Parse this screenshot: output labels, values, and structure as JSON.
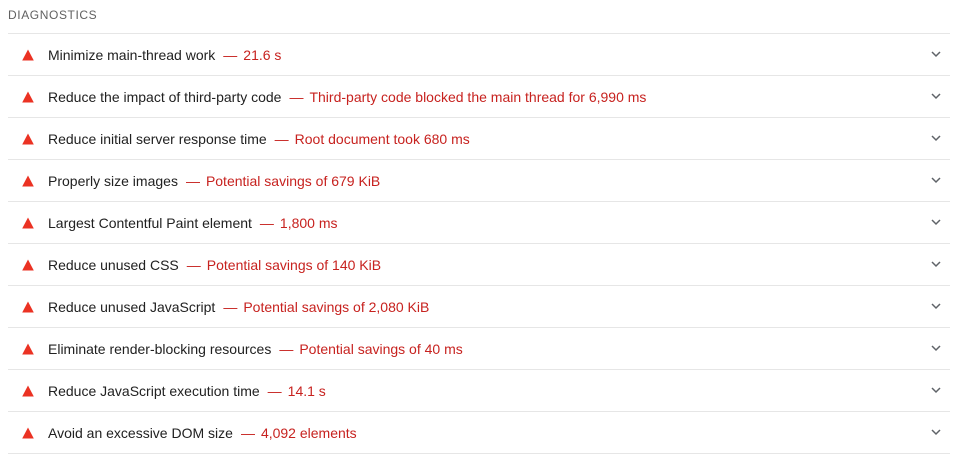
{
  "section": {
    "title": "DIAGNOSTICS"
  },
  "audits": [
    {
      "title": "Minimize main-thread work",
      "separator": "—",
      "value": "21.6 s"
    },
    {
      "title": "Reduce the impact of third-party code",
      "separator": "—",
      "value": "Third-party code blocked the main thread for 6,990 ms"
    },
    {
      "title": "Reduce initial server response time",
      "separator": "—",
      "value": "Root document took 680 ms"
    },
    {
      "title": "Properly size images",
      "separator": "—",
      "value": "Potential savings of 679 KiB"
    },
    {
      "title": "Largest Contentful Paint element",
      "separator": "—",
      "value": "1,800 ms"
    },
    {
      "title": "Reduce unused CSS",
      "separator": "—",
      "value": "Potential savings of 140 KiB"
    },
    {
      "title": "Reduce unused JavaScript",
      "separator": "—",
      "value": "Potential savings of 2,080 KiB"
    },
    {
      "title": "Eliminate render-blocking resources",
      "separator": "—",
      "value": "Potential savings of 40 ms"
    },
    {
      "title": "Reduce JavaScript execution time",
      "separator": "—",
      "value": "14.1 s"
    },
    {
      "title": "Avoid an excessive DOM size",
      "separator": "—",
      "value": "4,092 elements"
    }
  ],
  "icons": {
    "status": "fail-triangle-icon",
    "expand": "chevron-down-icon"
  },
  "colors": {
    "fail": "#eb3223",
    "value_text": "#c7221f",
    "divider": "#e6e6e6",
    "section_title": "#616161"
  }
}
